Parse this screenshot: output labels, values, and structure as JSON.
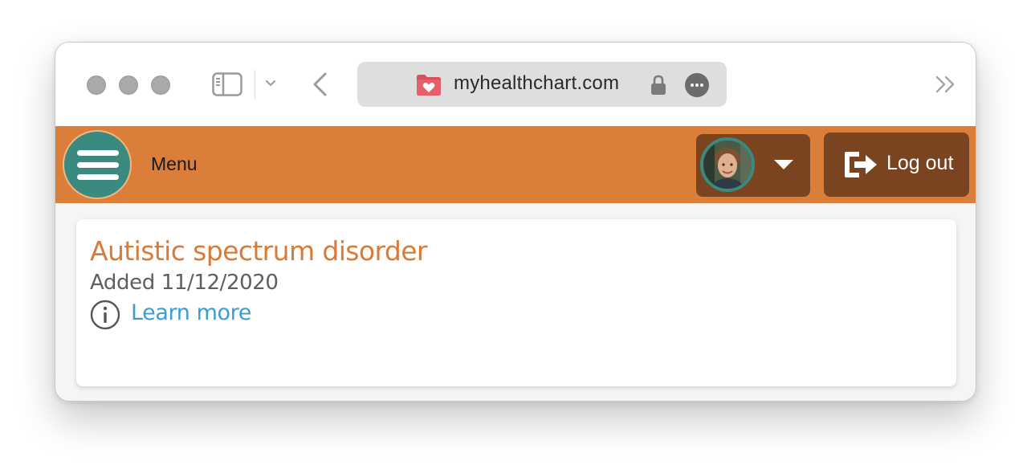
{
  "browser": {
    "url": "myhealthchart.com",
    "icons": {
      "sidebar": "sidebar-icon",
      "tab_menu": "chevron-down-icon",
      "back": "back-chevron-icon",
      "site": "health-folder-icon",
      "lock": "lock-icon",
      "more": "ellipsis-icon",
      "overflow": "double-chevron-right-icon"
    }
  },
  "header": {
    "menu_label": "Menu",
    "logout_label": "Log out",
    "colors": {
      "bar": "#db7e3a",
      "button": "#7b4420",
      "menu_circle": "#3a8a80"
    }
  },
  "condition": {
    "title": "Autistic spectrum disorder",
    "added": "Added 11/12/2020",
    "learn_more": "Learn more",
    "colors": {
      "title": "#d97b37",
      "link": "#3b9dd1"
    }
  }
}
